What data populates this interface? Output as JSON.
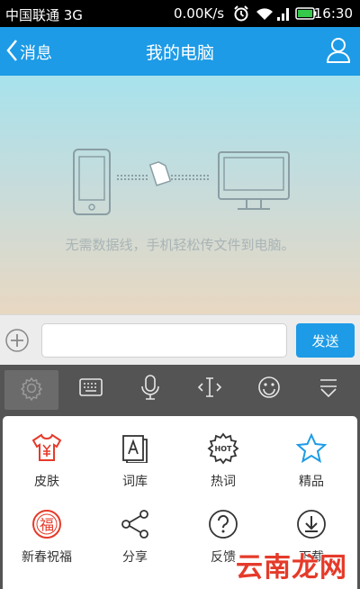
{
  "status_bar": {
    "carrier": "中国联通 3G",
    "speed": "0.00K/s",
    "time": "16:30"
  },
  "header": {
    "back_label": "消息",
    "title": "我的电脑"
  },
  "content": {
    "hint": "无需数据线，手机轻松传文件到电脑。"
  },
  "composer": {
    "input_value": "",
    "send_label": "发送"
  },
  "toolbar": {
    "icons": [
      "gear-icon",
      "keyboard-icon",
      "microphone-icon",
      "text-cursor-icon",
      "smiley-icon",
      "collapse-icon"
    ]
  },
  "panel": {
    "items": [
      {
        "label": "皮肤",
        "icon": "skin-shirt-icon"
      },
      {
        "label": "词库",
        "icon": "dictionary-icon"
      },
      {
        "label": "热词",
        "icon": "hot-badge-icon",
        "badge": "HOT"
      },
      {
        "label": "精品",
        "icon": "star-icon"
      },
      {
        "label": "新春祝福",
        "icon": "blessing-icon",
        "glyph": "福"
      },
      {
        "label": "分享",
        "icon": "share-icon"
      },
      {
        "label": "反馈",
        "icon": "question-icon"
      },
      {
        "label": "下载",
        "icon": "download-icon"
      }
    ]
  },
  "watermark": "云南龙网",
  "colors": {
    "accent": "#1d9be6",
    "red": "#e53a2a",
    "dark": "#545454"
  }
}
